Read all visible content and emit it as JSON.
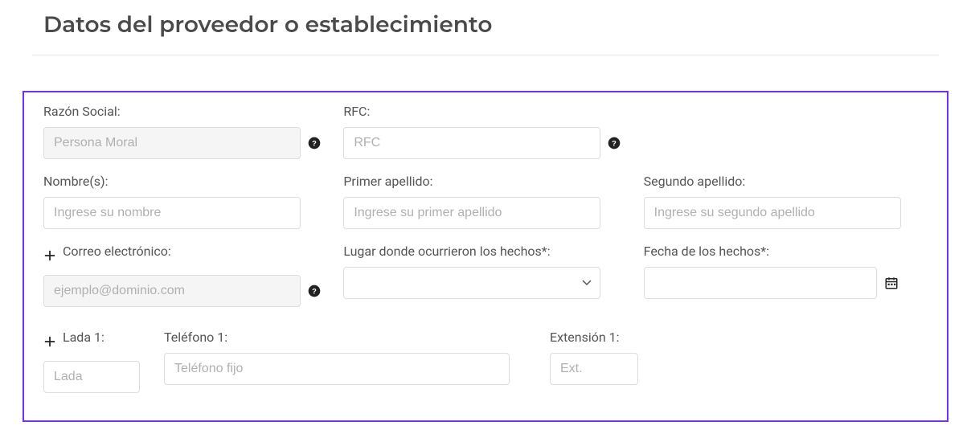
{
  "title": "Datos del proveedor o establecimiento",
  "fields": {
    "razon": {
      "label": "Razón Social:",
      "placeholder": "Persona Moral",
      "value": ""
    },
    "rfc": {
      "label": "RFC:",
      "placeholder": "RFC",
      "value": ""
    },
    "nombres": {
      "label": "Nombre(s):",
      "placeholder": "Ingrese su nombre",
      "value": ""
    },
    "primer_apellido": {
      "label": "Primer apellido:",
      "placeholder": "Ingrese su primer apellido",
      "value": ""
    },
    "segundo_apellido": {
      "label": "Segundo apellido:",
      "placeholder": "Ingrese su segundo apellido",
      "value": ""
    },
    "correo": {
      "label": "Correo electrónico:",
      "placeholder": "ejemplo@dominio.com",
      "value": ""
    },
    "lugar": {
      "label": "Lugar donde ocurrieron los hechos*:",
      "selected": ""
    },
    "fecha": {
      "label": "Fecha de los hechos*:",
      "value": ""
    },
    "lada1": {
      "label": "Lada 1:",
      "placeholder": "Lada",
      "value": ""
    },
    "telefono1": {
      "label": "Teléfono 1:",
      "placeholder": "Teléfono fijo",
      "value": ""
    },
    "extension1": {
      "label": "Extensión 1:",
      "placeholder": "Ext.",
      "value": ""
    }
  }
}
